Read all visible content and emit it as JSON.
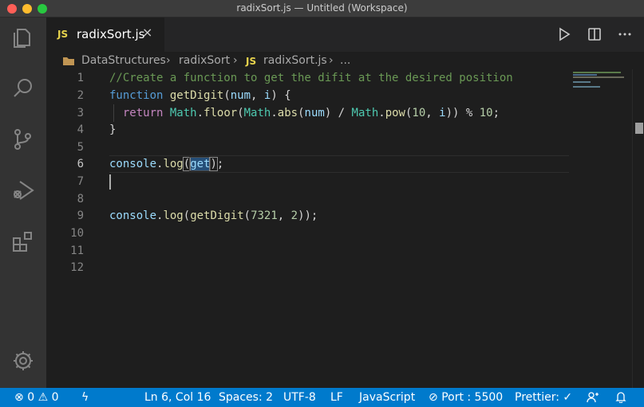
{
  "window": {
    "title": "radixSort.js — Untitled (Workspace)"
  },
  "activity_bar": {
    "items": [
      "explorer-icon",
      "search-icon",
      "source-control-icon",
      "run-debug-icon",
      "extensions-icon"
    ],
    "bottom": [
      "settings-gear-icon"
    ]
  },
  "tab": {
    "lang_badge": "JS",
    "label": "radixSort.js",
    "close": "×"
  },
  "tab_actions": [
    "run-icon",
    "split-editor-icon",
    "more-actions-icon"
  ],
  "breadcrumb": {
    "folder": "DataStructures",
    "subfolder": "radixSort",
    "file_badge": "JS",
    "file": "radixSort.js",
    "ellipsis": "..."
  },
  "editor": {
    "line_numbers": [
      "1",
      "2",
      "3",
      "4",
      "5",
      "6",
      "7",
      "8",
      "9",
      "10",
      "11",
      "12"
    ],
    "active_line": 6,
    "code": {
      "l1_comment": "//Create a function to get the difit at the desired position",
      "l2_kw": "function",
      "l2_fn": "getDigit",
      "l2_p1": "(",
      "l2_num": "num",
      "l2_comma": ", ",
      "l2_i": "i",
      "l2_end": ") {",
      "l3_return": "return",
      "l3_math1": "Math",
      "l3_dot1": ".",
      "l3_floor": "floor",
      "l3_p1": "(",
      "l3_math2": "Math",
      "l3_dot2": ".",
      "l3_abs": "abs",
      "l3_p2": "(",
      "l3_num": "num",
      "l3_div": ") / ",
      "l3_math3": "Math",
      "l3_dot3": ".",
      "l3_pow": "pow",
      "l3_p3": "(",
      "l3_ten": "10",
      "l3_comma": ", ",
      "l3_i": "i",
      "l3_mod": ")) % ",
      "l3_ten2": "10",
      "l3_semi": ";",
      "l4": "}",
      "l6_console": "console",
      "l6_dot": ".",
      "l6_log": "log",
      "l6_open": "(",
      "l6_get": "get",
      "l6_close": ")",
      "l6_semi": ";",
      "l9_console": "console",
      "l9_dot": ".",
      "l9_log": "log",
      "l9_open": "(",
      "l9_fn": "getDigit",
      "l9_open2": "(",
      "l9_n1": "7321",
      "l9_comma": ", ",
      "l9_n2": "2",
      "l9_close": "));"
    }
  },
  "status_bar": {
    "errors": "0",
    "warnings": "0",
    "position": "Ln 6, Col 16",
    "spaces": "Spaces: 2",
    "encoding": "UTF-8",
    "eol": "LF",
    "language": "JavaScript",
    "port": "Port : 5500",
    "prettier": "Prettier: ✓"
  },
  "colors": {
    "statusbar": "#007acc",
    "activitybar": "#333333",
    "editor_bg": "#1e1e1e",
    "js_badge": "#e8d44d"
  }
}
